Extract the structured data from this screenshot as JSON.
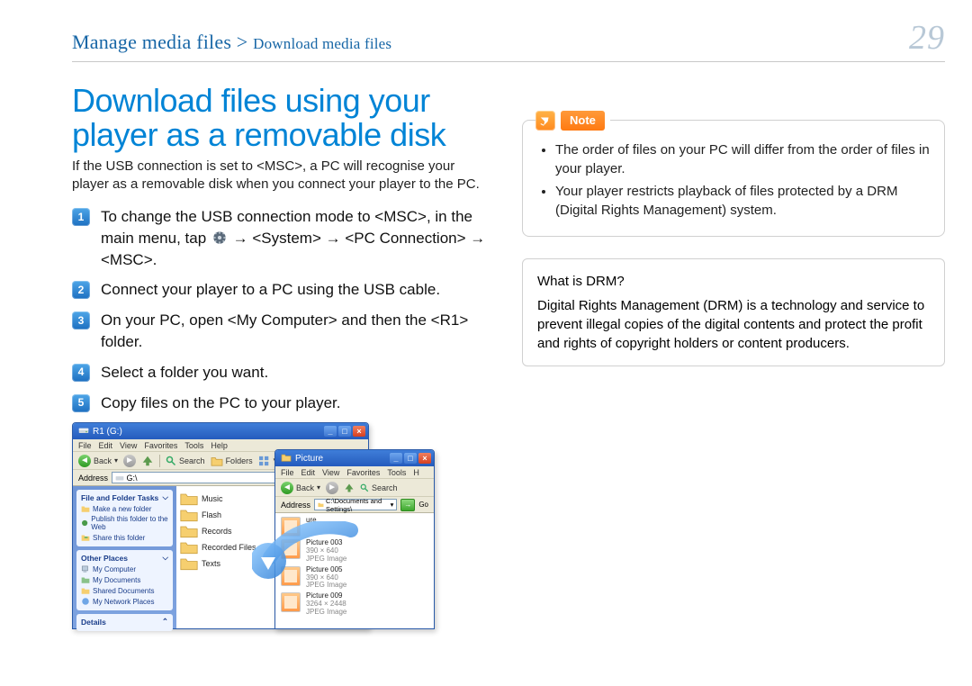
{
  "header": {
    "crumb_main": "Manage media files",
    "crumb_sep": " > ",
    "crumb_sub": "Download media files",
    "page_number": "29"
  },
  "title": "Download files using your player as a removable disk",
  "intro": "If the USB connection is set to <MSC>, a PC will recognise your player as a removable disk when you connect your player to the PC.",
  "steps": {
    "s1a": "To change the USB connection mode to <MSC>, in the main menu, tap ",
    "s1b": " → <System> → <PC Connection> → <MSC>.",
    "s2": "Connect your player to a PC using the USB cable.",
    "s3": "On your PC, open <My Computer> and then the <R1> folder.",
    "s4": "Select a folder you want.",
    "s5": "Copy files on the PC to your player."
  },
  "note": {
    "label": "Note",
    "items": [
      "The order of files on your PC will differ from the order of files in your player.",
      "Your player restricts playback of files protected by a DRM (Digital Rights Management) system."
    ]
  },
  "drm": {
    "heading": "What is DRM?",
    "body": "Digital Rights Management (DRM) is a technology and service to prevent illegal copies of the digital contents and protect the profit and rights of copyright holders or content producers."
  },
  "explorer": {
    "win1": {
      "title": "R1 (G:)",
      "menus": [
        "File",
        "Edit",
        "View",
        "Favorites",
        "Tools",
        "Help"
      ],
      "back": "Back",
      "search": "Search",
      "folders_btn": "Folders",
      "addr_label": "Address",
      "addr_value": "G:\\",
      "side": {
        "g1_title": "File and Folder Tasks",
        "g1_items": [
          "Make a new folder",
          "Publish this folder to the Web",
          "Share this folder"
        ],
        "g2_title": "Other Places",
        "g2_items": [
          "My Computer",
          "My Documents",
          "Shared Documents",
          "My Network Places"
        ],
        "g3_title": "Details"
      },
      "folders": [
        "Music",
        "Flash",
        "Records",
        "Recorded Files",
        "Texts"
      ]
    },
    "win2": {
      "title": "Picture",
      "menus": [
        "File",
        "Edit",
        "View",
        "Favorites",
        "Tools",
        "H"
      ],
      "back": "Back",
      "search": "Search",
      "addr_label": "Address",
      "addr_value": "C:\\Documents and Settings\\",
      "go": "Go",
      "thumbs": [
        {
          "name": "ure",
          "dims": "",
          "type": ""
        },
        {
          "name": "Picture 003",
          "dims": "390 × 640",
          "type": "JPEG Image"
        },
        {
          "name": "Picture 005",
          "dims": "390 × 640",
          "type": "JPEG Image"
        },
        {
          "name": "Picture 009",
          "dims": "3264 × 2448",
          "type": "JPEG Image"
        }
      ]
    }
  }
}
